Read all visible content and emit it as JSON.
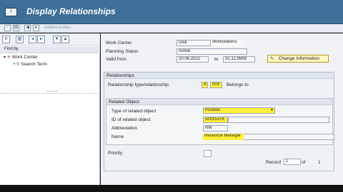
{
  "window": {
    "icon_text": "ꟾ",
    "title": "Display Relationships"
  },
  "toolbar": {
    "additional_data": "Additional data"
  },
  "nav": {
    "find_by": "Find by",
    "tree": [
      {
        "label": "Work Center",
        "toggle": "▾"
      },
      {
        "label": "Search Term",
        "toggle": "•"
      }
    ]
  },
  "header": {
    "work_center_label": "Work Center",
    "work_center_abbr": "Disk",
    "work_center_name": "Workstation1",
    "planning_status_label": "Planning Status",
    "planning_status_value": "Active",
    "valid_from_label": "Valid from",
    "valid_from": "20.06.2022",
    "to_label": "to",
    "valid_to": "31.12.9999",
    "change_info_button": "Change Information"
  },
  "relationships": {
    "title": "Relationships",
    "type_label": "Relationship type/relationship",
    "type_code": "A",
    "rel_code": "003",
    "rel_text": "Belongs to"
  },
  "related_object": {
    "title": "Related Object",
    "type_label": "Type of related object",
    "type_value": "Position",
    "id_label": "ID of related object",
    "id_value": "50015376",
    "abbr_label": "Abbreviation",
    "abbr_value": "RM",
    "name_label": "Name",
    "name_value": "Resource Manager"
  },
  "priority": {
    "label": "Priority",
    "value": ""
  },
  "record": {
    "label": "Record",
    "current": "1",
    "of_label": "of",
    "total": "1"
  },
  "colors": {
    "titlebar": "#3d6f98",
    "highlight": "#ffef3a",
    "panel": "#f0f2f5"
  },
  "icons": [
    "save-icon",
    "copy-icon",
    "back-icon",
    "exit-icon",
    "cancel-icon",
    "expand-icon",
    "collapse-icon",
    "dropdown-icon",
    "change-info-icon"
  ]
}
